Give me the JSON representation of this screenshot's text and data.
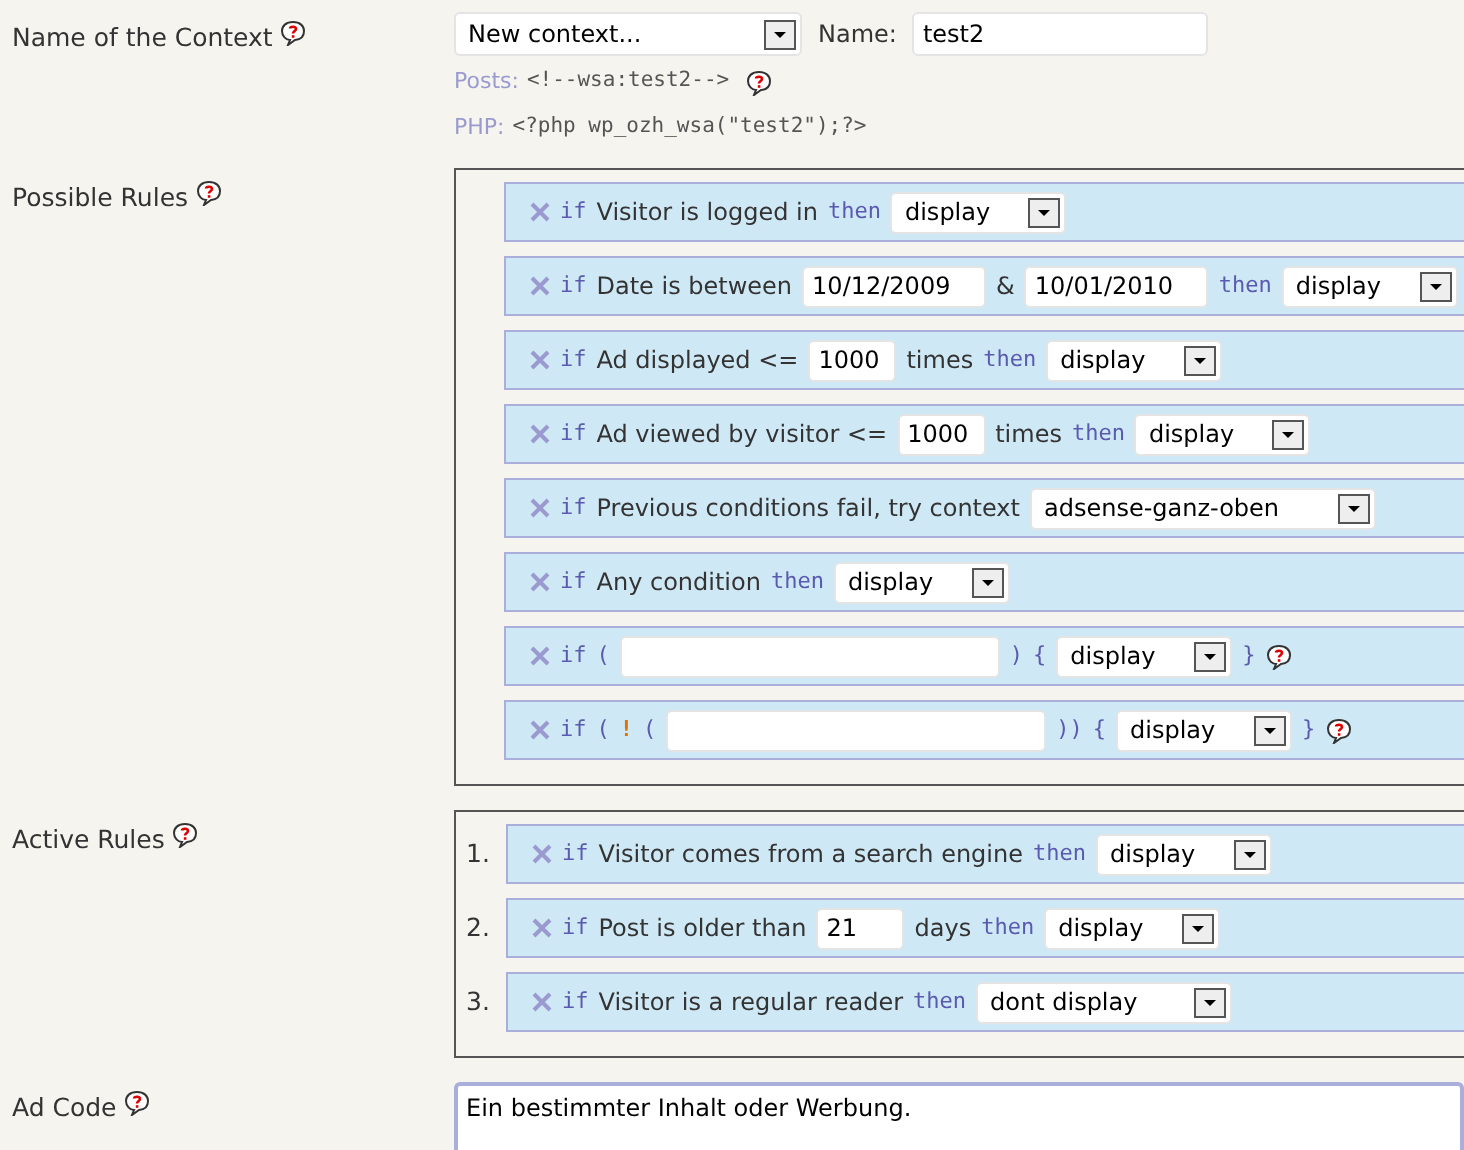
{
  "context": {
    "label": "Name of the Context",
    "select": "New context...",
    "name_label": "Name:",
    "name_value": "test2",
    "posts_label": "Posts:",
    "posts_code": "<!--wsa:test2-->",
    "php_label": "PHP:",
    "php_code": "<?php wp_ozh_wsa(\"test2\");?>"
  },
  "possible_rules": {
    "label": "Possible Rules",
    "rules": [
      {
        "parts": [
          {
            "kind": "kw",
            "text": "if"
          },
          {
            "kind": "text",
            "text": "Visitor is logged in"
          },
          {
            "kind": "kw",
            "text": "then"
          },
          {
            "kind": "select",
            "text": "display"
          }
        ]
      },
      {
        "parts": [
          {
            "kind": "kw",
            "text": "if"
          },
          {
            "kind": "text",
            "text": "Date is between"
          },
          {
            "kind": "input",
            "text": "10/12/2009"
          },
          {
            "kind": "text",
            "text": "&"
          },
          {
            "kind": "input",
            "text": "10/01/2010"
          },
          {
            "kind": "kw",
            "text": "then"
          },
          {
            "kind": "select",
            "text": "display"
          }
        ]
      },
      {
        "parts": [
          {
            "kind": "kw",
            "text": "if"
          },
          {
            "kind": "text",
            "text": "Ad displayed <="
          },
          {
            "kind": "input",
            "text": "1000"
          },
          {
            "kind": "text",
            "text": "times"
          },
          {
            "kind": "kw",
            "text": "then"
          },
          {
            "kind": "select",
            "text": "display"
          }
        ]
      },
      {
        "parts": [
          {
            "kind": "kw",
            "text": "if"
          },
          {
            "kind": "text",
            "text": "Ad viewed by visitor <="
          },
          {
            "kind": "input",
            "text": "1000"
          },
          {
            "kind": "text",
            "text": "times"
          },
          {
            "kind": "kw",
            "text": "then"
          },
          {
            "kind": "select",
            "text": "display"
          }
        ]
      },
      {
        "parts": [
          {
            "kind": "kw",
            "text": "if"
          },
          {
            "kind": "text",
            "text": "Previous conditions fail, try context"
          },
          {
            "kind": "select",
            "text": "adsense-ganz-oben"
          }
        ]
      },
      {
        "parts": [
          {
            "kind": "kw",
            "text": "if"
          },
          {
            "kind": "text",
            "text": "Any condition"
          },
          {
            "kind": "kw",
            "text": "then"
          },
          {
            "kind": "select",
            "text": "display"
          }
        ]
      },
      {
        "parts": [
          {
            "kind": "kw",
            "text": "if"
          },
          {
            "kind": "kw",
            "text": "("
          },
          {
            "kind": "input"
          },
          {
            "kind": "kw",
            "text": ")"
          },
          {
            "kind": "kw",
            "text": "{"
          },
          {
            "kind": "select",
            "text": "display"
          },
          {
            "kind": "kw",
            "text": "}"
          },
          {
            "kind": "help"
          }
        ]
      },
      {
        "parts": [
          {
            "kind": "kw",
            "text": "if"
          },
          {
            "kind": "kw",
            "text": "("
          },
          {
            "kind": "bang",
            "text": "!"
          },
          {
            "kind": "kw",
            "text": "("
          },
          {
            "kind": "input"
          },
          {
            "kind": "kw",
            "text": "))"
          },
          {
            "kind": "kw",
            "text": "{"
          },
          {
            "kind": "select",
            "text": "display"
          },
          {
            "kind": "kw",
            "text": "}"
          },
          {
            "kind": "help"
          }
        ]
      }
    ]
  },
  "active_rules": {
    "label": "Active Rules",
    "rules": [
      {
        "number": "1.",
        "parts": [
          {
            "kind": "kw",
            "text": "if"
          },
          {
            "kind": "text",
            "text": "Visitor comes from a search engine"
          },
          {
            "kind": "kw",
            "text": "then"
          },
          {
            "kind": "select",
            "text": "display"
          }
        ]
      },
      {
        "number": "2.",
        "parts": [
          {
            "kind": "kw",
            "text": "if"
          },
          {
            "kind": "text",
            "text": "Post is older than"
          },
          {
            "kind": "input",
            "text": "21"
          },
          {
            "kind": "text",
            "text": "days"
          },
          {
            "kind": "kw",
            "text": "then"
          },
          {
            "kind": "select",
            "text": "display"
          }
        ]
      },
      {
        "number": "3.",
        "parts": [
          {
            "kind": "kw",
            "text": "if"
          },
          {
            "kind": "text",
            "text": "Visitor is a regular reader"
          },
          {
            "kind": "kw",
            "text": "then"
          },
          {
            "kind": "select",
            "text": "dont display"
          }
        ]
      }
    ]
  },
  "ad_code": {
    "label": "Ad Code",
    "value": "Ein bestimmter Inhalt oder Werbung."
  }
}
